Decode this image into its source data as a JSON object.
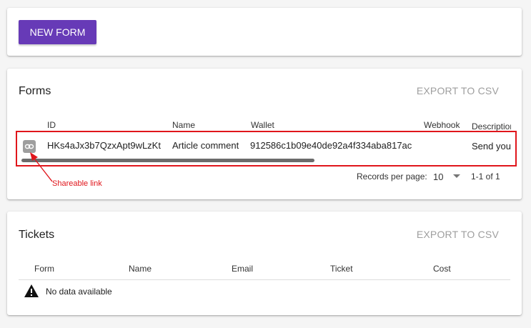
{
  "new_form_card": {
    "button_label": "NEW FORM"
  },
  "forms_card": {
    "title": "Forms",
    "export_label": "EXPORT TO CSV",
    "columns": [
      "ID",
      "Name",
      "Wallet",
      "Webhook",
      "Description"
    ],
    "rows": [
      {
        "id": "HKs4aJx3b7QzxApt9wLzKt",
        "name": "Article comment",
        "wallet": "912586c1b09e40de92a4f334aba817ac",
        "webhook": "",
        "description": "Send you"
      }
    ],
    "pager": {
      "records_label": "Records per page:",
      "records_value": "10",
      "range": "1-1 of 1"
    }
  },
  "annotation": {
    "label": "Shareable link",
    "color": "#e0151b"
  },
  "tickets_card": {
    "title": "Tickets",
    "export_label": "EXPORT TO CSV",
    "columns": [
      "Form",
      "Name",
      "Email",
      "Ticket",
      "Cost"
    ],
    "empty_text": "No data available"
  },
  "colors": {
    "primary": "#673ab7",
    "annotation": "#e0151b",
    "disabled": "#9e9e9e"
  }
}
